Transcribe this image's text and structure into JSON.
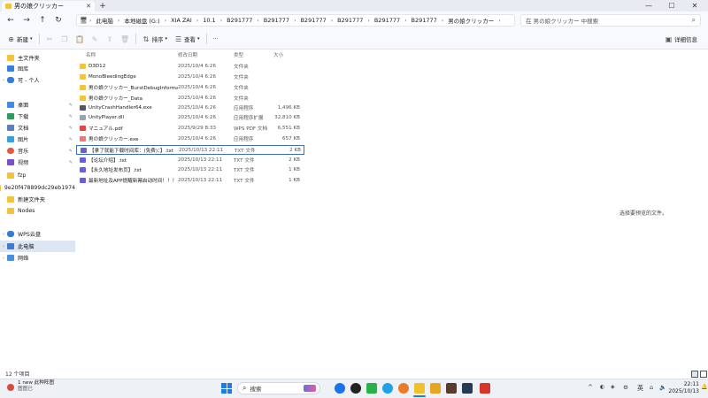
{
  "window": {
    "tab_title": "男の娘クリッカー",
    "tab_close": "✕",
    "new_tab": "+",
    "controls": {
      "minimize": "—",
      "maximize": "☐",
      "close": "✕"
    }
  },
  "nav": {
    "back": "←",
    "forward": "→",
    "up": "↑",
    "refresh": "↻"
  },
  "breadcrumb": [
    "此电脑",
    "本地磁盘 (G:)",
    "XIA ZAI",
    "10.1",
    "B291777",
    "B291777",
    "B291777",
    "B291777",
    "B291777",
    "B291777",
    "男の娘クリッカー"
  ],
  "search": {
    "placeholder": "在 男の娘クリッカー 中搜索"
  },
  "toolbar": {
    "new_label": "新建",
    "sort_label": "排序",
    "view_label": "查看",
    "more_label": "···",
    "details_label": "详细信息"
  },
  "sidebar": {
    "items": [
      {
        "label": "主文件夹",
        "icon": "home-icon",
        "pinned": false
      },
      {
        "label": "图库",
        "icon": "gallery-icon",
        "pinned": false
      },
      {
        "label": "可 - 个人",
        "icon": "cloud-icon",
        "pinned": false
      },
      {
        "label": "桌面",
        "icon": "desktop-icon",
        "pinned": true
      },
      {
        "label": "下载",
        "icon": "download-icon",
        "pinned": true
      },
      {
        "label": "文档",
        "icon": "documents-icon",
        "pinned": true
      },
      {
        "label": "图片",
        "icon": "pictures-icon",
        "pinned": true
      },
      {
        "label": "音乐",
        "icon": "music-icon",
        "pinned": true
      },
      {
        "label": "视频",
        "icon": "videos-icon",
        "pinned": true
      },
      {
        "label": "fzp",
        "icon": "folder-icon",
        "pinned": false
      },
      {
        "label": "9e20f478899dc29eb1974",
        "icon": "folder-icon",
        "pinned": false
      },
      {
        "label": "新建文件夹",
        "icon": "folder-icon",
        "pinned": false
      },
      {
        "label": "Nodes",
        "icon": "folder-icon",
        "pinned": false
      },
      {
        "label": "WPS云盘",
        "icon": "cloud-drive-icon",
        "pinned": false
      },
      {
        "label": "此电脑",
        "icon": "computer-icon",
        "pinned": false
      },
      {
        "label": "网络",
        "icon": "network-icon",
        "pinned": false
      }
    ]
  },
  "columns": {
    "name": "名称",
    "date": "修改日期",
    "type": "类型",
    "size": "大小"
  },
  "files": [
    {
      "name": "D3D12",
      "date": "2025/10/4 6:26",
      "type": "文件夹",
      "size": "",
      "icon": "folder"
    },
    {
      "name": "MonoBleedingEdge",
      "date": "2025/10/4 6:26",
      "type": "文件夹",
      "size": "",
      "icon": "folder"
    },
    {
      "name": "男の娘クリッカー_BurstDebugInforma...",
      "date": "2025/10/4 6:26",
      "type": "文件夹",
      "size": "",
      "icon": "folder"
    },
    {
      "name": "男の娘クリッカー_Data",
      "date": "2025/10/4 6:26",
      "type": "文件夹",
      "size": "",
      "icon": "folder"
    },
    {
      "name": "UnityCrashHandler64.exe",
      "date": "2025/10/4 6:26",
      "type": "应用程序",
      "size": "1,496 KB",
      "icon": "exe"
    },
    {
      "name": "UnityPlayer.dll",
      "date": "2025/10/4 6:26",
      "type": "应用程序扩展",
      "size": "32,810 KB",
      "icon": "dll"
    },
    {
      "name": "マニュアル.pdf",
      "date": "2025/9/29 8:33",
      "type": "WPS PDF 文档",
      "size": "6,551 KB",
      "icon": "pdf"
    },
    {
      "name": "男の娘クリッカー.exe",
      "date": "2025/10/4 6:26",
      "type": "应用程序",
      "size": "657 KB",
      "icon": "game"
    },
    {
      "name": "【拿了就能下载时间库：(免费)：】.txt",
      "date": "2025/10/13 22:11",
      "type": "TXT 文件",
      "size": "2 KB",
      "icon": "txt"
    },
    {
      "name": "【论坛介绍】.txt",
      "date": "2025/10/13 22:11",
      "type": "TXT 文件",
      "size": "2 KB",
      "icon": "txt"
    },
    {
      "name": "【永久地址发布页】.txt",
      "date": "2025/10/13 22:11",
      "type": "TXT 文件",
      "size": "1 KB",
      "icon": "txt"
    },
    {
      "name": "最新地址及APP提醒新幂启动时间！！！",
      "date": "2025/10/13 22:11",
      "type": "TXT 文件",
      "size": "1 KB",
      "icon": "txt"
    }
  ],
  "preview_text": "选择要预览的文件。",
  "status": {
    "item_count": "12 个项目"
  },
  "taskbar": {
    "weather_line1": "1 new 此种阵图",
    "weather_line2": "图图已",
    "search_label": "搜索",
    "ime": "英",
    "time": "22:11",
    "date": "2025/10/13",
    "tray_chevron": "^"
  }
}
